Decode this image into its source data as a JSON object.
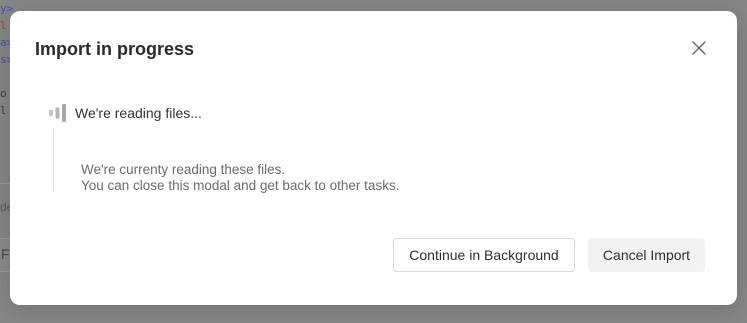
{
  "background": {
    "code_fragments": [
      "y>",
      "l",
      "a>",
      "s>",
      "",
      "o",
      "l"
    ],
    "code_colors": [
      "#4a4ab0",
      "#b03030",
      "#4a4ab0",
      "#4a4ab0",
      "#4a4ab0",
      "#3a3a3a",
      "#3a3a3a"
    ],
    "label_fragment": "de",
    "field_fragment": "F"
  },
  "modal": {
    "title": "Import in progress",
    "close_icon": "close-icon",
    "status": {
      "icon": "loading-bars-icon",
      "text": "We're reading files..."
    },
    "description": {
      "line1": "We're currenty reading these files.",
      "line2": "You can close this modal and get back to other tasks."
    },
    "buttons": {
      "continue_label": "Continue in Background",
      "cancel_label": "Cancel Import"
    }
  },
  "colors": {
    "overlay": "#878787",
    "modal_bg": "#ffffff",
    "cancel_bg": "#f2f2f2",
    "icon_gray": "#b5b5b5"
  }
}
